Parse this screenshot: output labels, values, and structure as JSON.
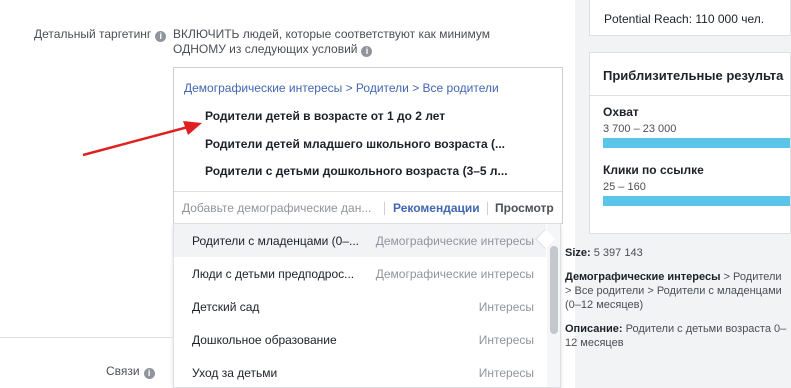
{
  "targeting": {
    "label": "Детальный таргетинг",
    "include_text": "ВКЛЮЧИТЬ людей, которые соответствуют как минимум ОДНОМУ из следующих условий",
    "breadcrumb": "Демографические интересы > Родители > Все родители",
    "selected": [
      "Родители детей в возрасте от 1 до 2 лет",
      "Родители детей младшего школьного возраста (...",
      "Родители с детьми дошкольного возраста (3–5 л..."
    ],
    "search_placeholder": "Добавьте демографические дан...",
    "tab_recommendations": "Рекомендации",
    "tab_browse": "Просмотр"
  },
  "dropdown": {
    "items": [
      {
        "name": "Родители с младенцами (0–...",
        "category": "Демографические интересы"
      },
      {
        "name": "Люди с детьми предподрос...",
        "category": "Демографические интересы"
      },
      {
        "name": "Детский сад",
        "category": "Интересы"
      },
      {
        "name": "Дошкольное образование",
        "category": "Интересы"
      },
      {
        "name": "Уход за детьми",
        "category": "Интересы"
      }
    ]
  },
  "info_panel": {
    "size_label": "Size:",
    "size_value": "5 397 143",
    "path_label": "Демографические интересы",
    "path_value": "> Родители > Все родители > Родители с младенцами (0–12 месяцев)",
    "desc_label": "Описание:",
    "desc_value": "Родители с детьми возраста 0–12 месяцев"
  },
  "connections": {
    "label": "Связи"
  },
  "sidebar": {
    "potential_reach": "Potential Reach: 110 000 чел.",
    "results_title": "Приблизительные результа",
    "metrics": [
      {
        "label": "Охват",
        "range": "3 700 – 23 000",
        "fill_fraction": 1.0
      },
      {
        "label": "Клики по ссылке",
        "range": "25 – 160",
        "fill_fraction": 1.0
      }
    ]
  },
  "colors": {
    "accent_blue": "#4267b2",
    "bar_fill": "#5ac5e8",
    "annotation_arrow": "#e02020"
  },
  "icons": [
    "info-icon",
    "arrow-annotation-icon"
  ]
}
